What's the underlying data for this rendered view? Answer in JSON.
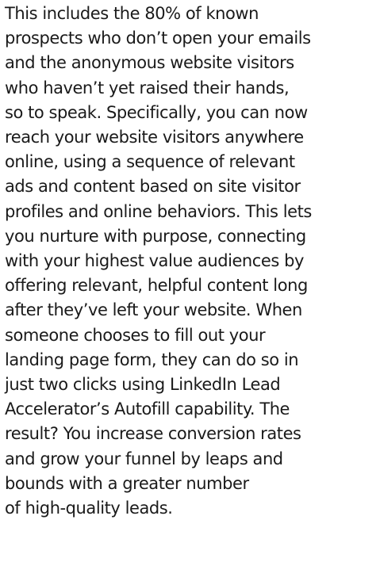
{
  "paragraph": {
    "lines": [
      "This includes the 80% of known",
      "prospects who don’t open your emails",
      "and the anonymous website visitors",
      "who haven’t yet raised their hands,",
      "so to speak. Specifically, you can now",
      "reach your website visitors anywhere",
      "online, using a sequence of relevant",
      "ads and content based on site visitor",
      "profiles and online behaviors. This lets",
      "you nurture with purpose, connecting",
      "with your highest value audiences by",
      "offering relevant, helpful content long",
      "after they’ve left your website. When",
      "someone chooses to fill out your",
      "landing page form, they can do so in",
      "just two clicks using LinkedIn Lead",
      "Accelerator’s Autofill capability. The",
      "result? You increase conversion rates",
      "and grow your funnel by leaps and",
      "bounds with a greater number",
      "of high-quality leads."
    ]
  }
}
